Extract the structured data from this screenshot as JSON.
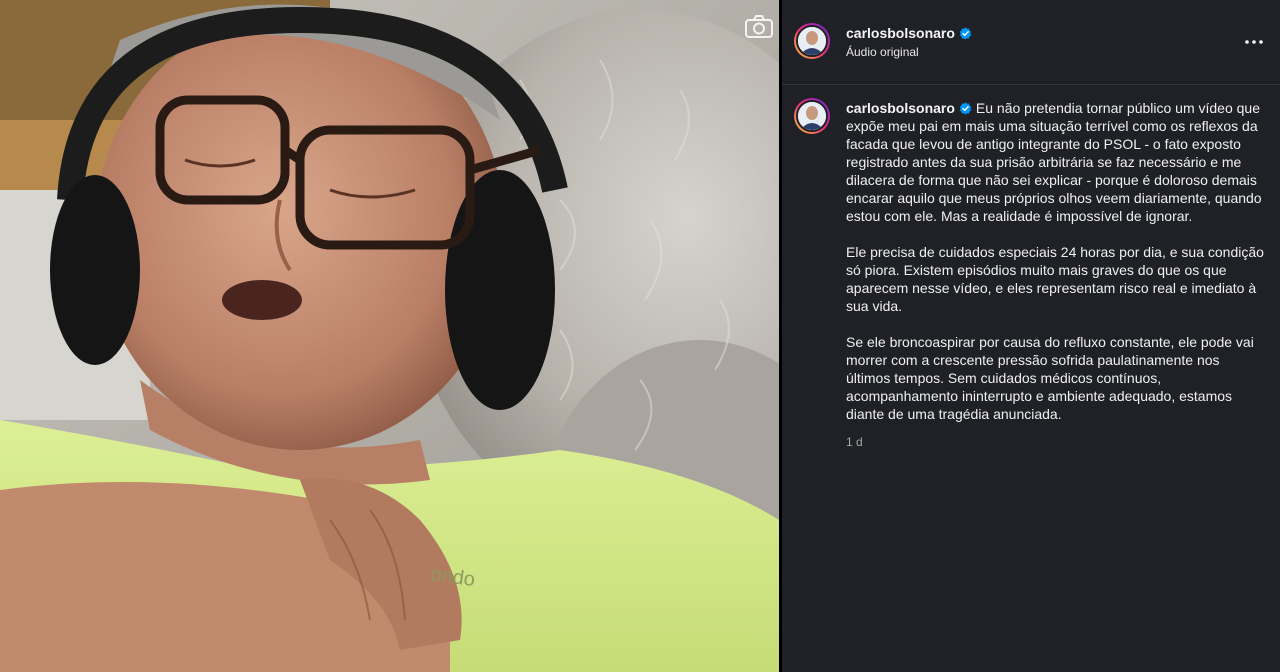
{
  "post": {
    "username": "carlosbolsonaro",
    "audio_label": "Áudio original",
    "caption_paragraphs": [
      "Eu não pretendia tornar público um vídeo que expõe meu pai em mais uma situação terrível como os reflexos da facada que levou de antigo integrante do PSOL - o fato exposto registrado antes da sua prisão arbitrária se faz necessário e me dilacera de forma que não sei explicar - porque é doloroso demais encarar aquilo que meus próprios olhos veem diariamente, quando estou com ele. Mas a realidade é impossível de ignorar.",
      "Ele precisa de cuidados especiais 24 horas por dia, e sua condição só piora. Existem episódios muito mais graves do que os que aparecem nesse vídeo, e eles representam risco real e imediato à sua vida.",
      "Se ele broncoaspirar por causa do refluxo constante, ele pode vai morrer com a crescente pressão sofrida paulatinamente nos últimos tempos. Sem cuidados médicos contínuos, acompanhamento ininterrupto e ambiente adequado, estamos diante de uma tragédia anunciada."
    ],
    "timestamp": "1 d",
    "shirt_logo_text": "ondo"
  },
  "icons": {
    "camera": "camera-icon",
    "verified": "verified-badge-icon",
    "more": "more-options-icon"
  },
  "colors": {
    "panel_bg": "#1f2126",
    "verified_blue": "#0095f6",
    "shirt": "#d6eb8c"
  }
}
